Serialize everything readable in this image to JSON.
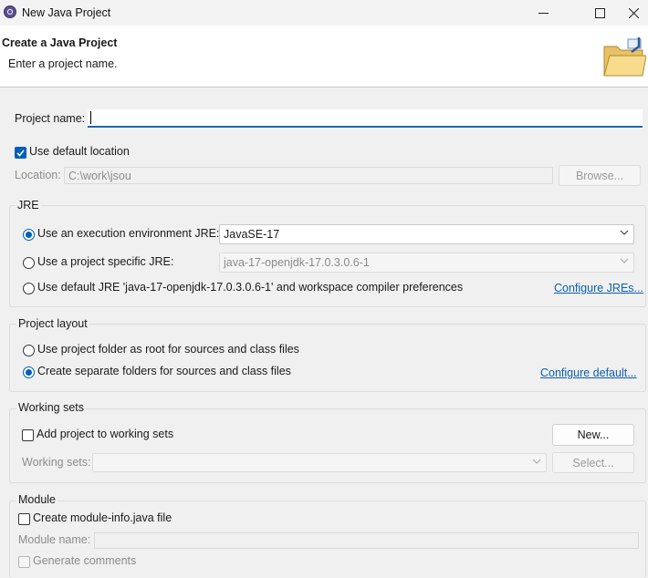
{
  "window": {
    "title": "New Java Project",
    "icon": "eclipse-icon"
  },
  "header": {
    "title": "Create a Java Project",
    "subtitle": "Enter a project name.",
    "banner_icon": "folder-icon"
  },
  "project_name": {
    "label": "Project name:",
    "value": ""
  },
  "location": {
    "use_default_label": "Use default location",
    "use_default_checked": true,
    "label": "Location:",
    "value": "C:\\work\\jsou",
    "browse_label": "Browse..."
  },
  "jre": {
    "title": "JRE",
    "options": [
      {
        "label": "Use an execution environment JRE:",
        "selected": true,
        "combo_value": "JavaSE-17"
      },
      {
        "label": "Use a project specific JRE:",
        "selected": false,
        "combo_value": "java-17-openjdk-17.0.3.0.6-1"
      },
      {
        "label": "Use default JRE 'java-17-openjdk-17.0.3.0.6-1' and workspace compiler preferences",
        "selected": false
      }
    ],
    "configure_link": "Configure JREs..."
  },
  "layout": {
    "title": "Project layout",
    "options": [
      {
        "label": "Use project folder as root for sources and class files",
        "selected": false
      },
      {
        "label": "Create separate folders for sources and class files",
        "selected": true
      }
    ],
    "configure_link": "Configure default..."
  },
  "working_sets": {
    "title": "Working sets",
    "add_label": "Add project to working sets",
    "add_checked": false,
    "new_label": "New...",
    "sets_label": "Working sets:",
    "select_label": "Select..."
  },
  "module": {
    "title": "Module",
    "create_label": "Create module-info.java file",
    "create_checked": false,
    "name_label": "Module name:",
    "comments_label": "Generate comments"
  },
  "colors": {
    "accent": "#005fb8",
    "link": "#0b5fb0",
    "background": "#f0f0f0"
  }
}
